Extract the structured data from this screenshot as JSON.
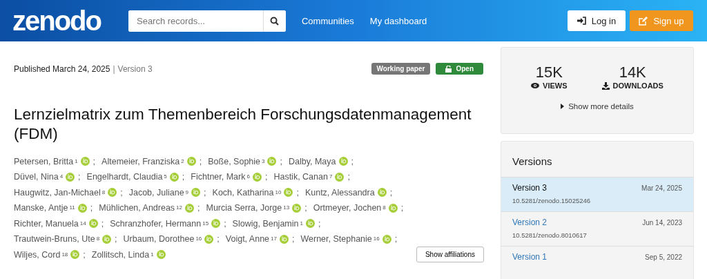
{
  "header": {
    "logo": "zenodo",
    "search": {
      "placeholder": "Search records..."
    },
    "nav": [
      "Communities",
      "My dashboard"
    ],
    "login": "Log in",
    "signup": "Sign up"
  },
  "record": {
    "published": "Published March 24, 2025",
    "separator": "|",
    "version": "Version 3",
    "badges": [
      {
        "kind": "type",
        "label": "Working paper"
      },
      {
        "kind": "access",
        "label": "Open"
      }
    ],
    "title": "Lernzielmatrix zum Themenbereich Forschungsdatenmanagement (FDM)",
    "author_lines": [
      [
        {
          "name": "Petersen, Britta",
          "aff": "1",
          "sep": ";"
        },
        {
          "name": "Altemeier, Franziska",
          "aff": "2",
          "sep": ";"
        },
        {
          "name": "Boße, Sophie",
          "aff": "3",
          "sep": ";"
        },
        {
          "name": "Dalby, Maya",
          "sep": ";"
        }
      ],
      [
        {
          "name": "Düvel, Nina",
          "aff": "4",
          "sep": ";"
        },
        {
          "name": "Engelhardt, Claudia",
          "aff": "5",
          "sep": ";"
        },
        {
          "name": "Fichtner, Mark",
          "aff": "6",
          "sep": ";"
        },
        {
          "name": "Hastik, Canan",
          "aff": "7",
          "sep": ";"
        }
      ],
      [
        {
          "name": "Haugwitz, Jan-Michael",
          "aff": "8",
          "sep": ";"
        },
        {
          "name": "Jacob, Juliane",
          "aff": "9",
          "sep": ";"
        },
        {
          "name": "Koch, Katharina",
          "aff": "10",
          "sep": ";"
        },
        {
          "name": "Kuntz, Alessandra",
          "sep": ";"
        }
      ],
      [
        {
          "name": "Manske, Antje",
          "aff": "11",
          "sep": ";"
        },
        {
          "name": "Mühlichen, Andreas",
          "aff": "12",
          "sep": ";"
        },
        {
          "name": "Murcia Serra, Jorge",
          "aff": "13",
          "sep": ";"
        },
        {
          "name": "Ortmeyer, Jochen",
          "aff": "8",
          "sep": ";"
        }
      ],
      [
        {
          "name": "Richter, Manuela",
          "aff": "14",
          "sep": ";"
        },
        {
          "name": "Schranzhofer, Hermann",
          "aff": "15",
          "sep": ";"
        },
        {
          "name": "Slowig, Benjamin",
          "aff": "1",
          "sep": ";"
        }
      ],
      [
        {
          "name": "Trautwein-Bruns, Ute",
          "aff": "8",
          "sep": ";"
        },
        {
          "name": "Urbaum, Dorothee",
          "aff": "16",
          "sep": ";"
        },
        {
          "name": "Voigt, Anne",
          "aff": "17",
          "sep": ";"
        },
        {
          "name": "Werner, Stephanie",
          "aff": "16",
          "sep": ";"
        }
      ],
      [
        {
          "name": "Wiljes, Cord",
          "aff": "18",
          "sep": ";"
        },
        {
          "name": "Zollitsch, Linda",
          "aff": "1"
        }
      ]
    ],
    "show_affiliations": "Show affiliations"
  },
  "stats": {
    "items": [
      {
        "kind": "views",
        "value": "15K",
        "label": "VIEWS"
      },
      {
        "kind": "downloads",
        "value": "14K",
        "label": "DOWNLOADS"
      }
    ],
    "more": "Show more details"
  },
  "versions": {
    "title": "Versions",
    "items": [
      {
        "label": "Version 3",
        "date": "Mar 24, 2025",
        "doi": "10.5281/zenodo.15025246",
        "selected": true
      },
      {
        "label": "Version 2",
        "date": "Jun 14, 2023",
        "doi": "10.5281/zenodo.8010617",
        "selected": false
      },
      {
        "label": "Version 1",
        "date": "Sep 5, 2022",
        "selected": false
      }
    ]
  }
}
